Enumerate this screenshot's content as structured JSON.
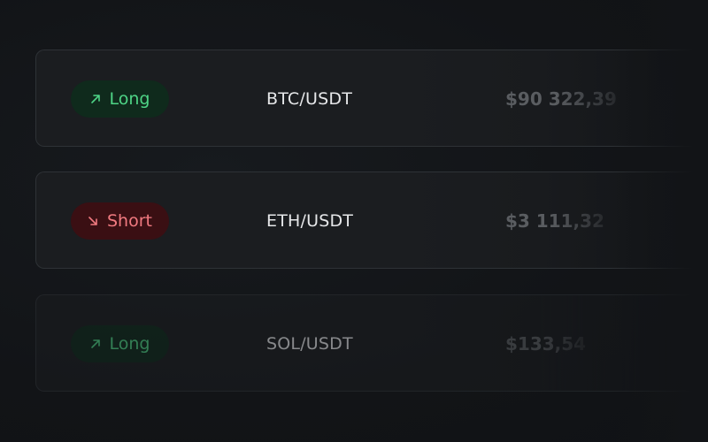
{
  "positions": [
    {
      "direction": "Long",
      "direction_icon": "arrow-up-right-icon",
      "pair": "BTC/USDT",
      "price": "$90 322,39"
    },
    {
      "direction": "Short",
      "direction_icon": "arrow-down-right-icon",
      "pair": "ETH/USDT",
      "price": "$3 111,32"
    },
    {
      "direction": "Long",
      "direction_icon": "arrow-up-right-icon",
      "pair": "SOL/USDT",
      "price": "$133,54"
    }
  ],
  "colors": {
    "background": "#121417",
    "long_text": "#4ed486",
    "long_bg": "#0f2a1c",
    "short_text": "#f07a80",
    "short_bg": "#3a0f13"
  }
}
